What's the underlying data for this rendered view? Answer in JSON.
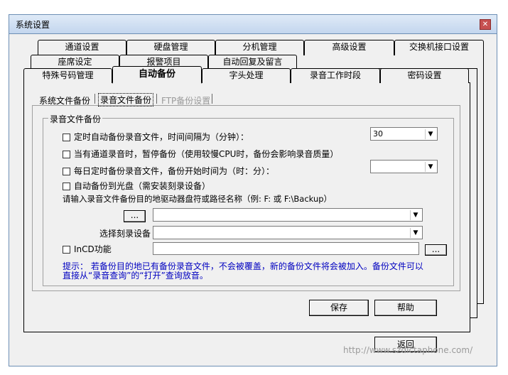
{
  "window": {
    "title": "系统设置",
    "close_glyph": "✕"
  },
  "tabs": {
    "row1": [
      "通道设置",
      "硬盘管理",
      "分机管理",
      "高级设置",
      "交换机接口设置"
    ],
    "row2": [
      "座席设定",
      "报警项目",
      "自动回复及留言"
    ],
    "row3": [
      "特殊号码管理",
      "自动备份",
      "字头处理",
      "录音工作时段",
      "密码设置"
    ]
  },
  "subtabs": [
    "系统文件备份",
    "录音文件备份",
    "FTP备份设置"
  ],
  "group": {
    "title": "录音文件备份",
    "opt_timed_label": "定时自动备份录音文件，时间间隔为（分钟）：",
    "opt_timed_value": "30",
    "opt_pause_label": "当有通道录音时，暂停备份（使用较慢CPU时，备份会影响录音质量）",
    "opt_daily_label": "每日定时备份录音文件，备份开始时间为（时：分）：",
    "opt_daily_value": "",
    "opt_cd_label": "自动备份到光盘（需安装刻录设备）",
    "path_prompt": "请输入录音文件备份目的地驱动器盘符或路径名称（例: F: 或 F:\\Backup）",
    "path_browse": "...",
    "path_value": "",
    "burner_label": "选择刻录设备",
    "burner_value": "",
    "incd_label": "InCD功能",
    "incd_value": "",
    "incd_browse": "...",
    "hint_line1": "提示： 若备份目的地已有备份录音文件，不会被覆盖，新的备份文件将会被加入。备份文件可以",
    "hint_line2": "直接从“录音查询”的“打开”查询放音。"
  },
  "buttons": {
    "save": "保存",
    "help": "帮助",
    "back": "返回"
  },
  "watermark": "http://www.szdictaphone.com/"
}
